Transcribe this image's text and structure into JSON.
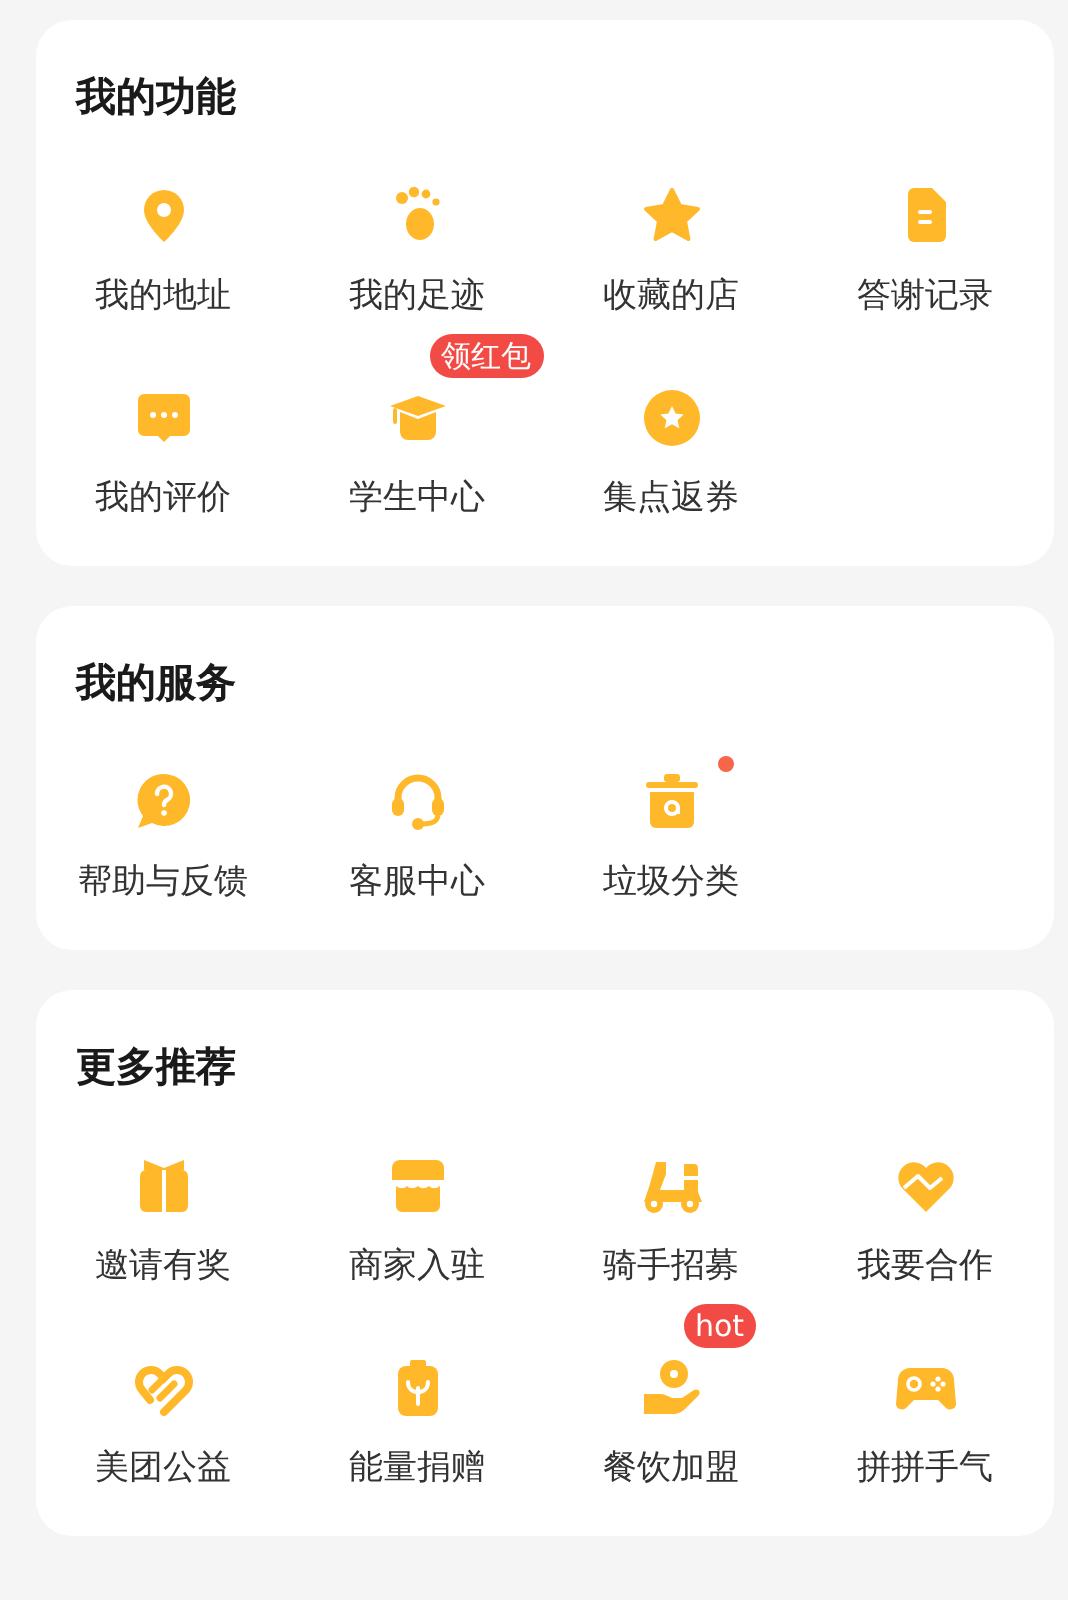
{
  "sections": [
    {
      "title": "我的功能",
      "items": [
        {
          "label": "我的地址",
          "dot": false
        },
        {
          "label": "我的足迹",
          "dot": false
        },
        {
          "label": "收藏的店",
          "dot": false
        },
        {
          "label": "答谢记录",
          "dot": false
        },
        {
          "label": "我的评价",
          "dot": false
        },
        {
          "label": "学生中心",
          "badge": "领红包",
          "dot": false
        },
        {
          "label": "集点返券",
          "dot": false
        }
      ]
    },
    {
      "title": "我的服务",
      "items": [
        {
          "label": "帮助与反馈",
          "dot": false
        },
        {
          "label": "客服中心",
          "dot": false
        },
        {
          "label": "垃圾分类",
          "dot": true
        }
      ]
    },
    {
      "title": "更多推荐",
      "items": [
        {
          "label": "邀请有奖",
          "dot": false
        },
        {
          "label": "商家入驻",
          "dot": false
        },
        {
          "label": "骑手招募",
          "dot": false
        },
        {
          "label": "我要合作",
          "dot": false
        },
        {
          "label": "美团公益",
          "dot": false
        },
        {
          "label": "能量捐赠",
          "dot": false
        },
        {
          "label": "餐饮加盟",
          "badge": "hot",
          "dot": false
        },
        {
          "label": "拼拼手气",
          "dot": false
        }
      ]
    }
  ]
}
